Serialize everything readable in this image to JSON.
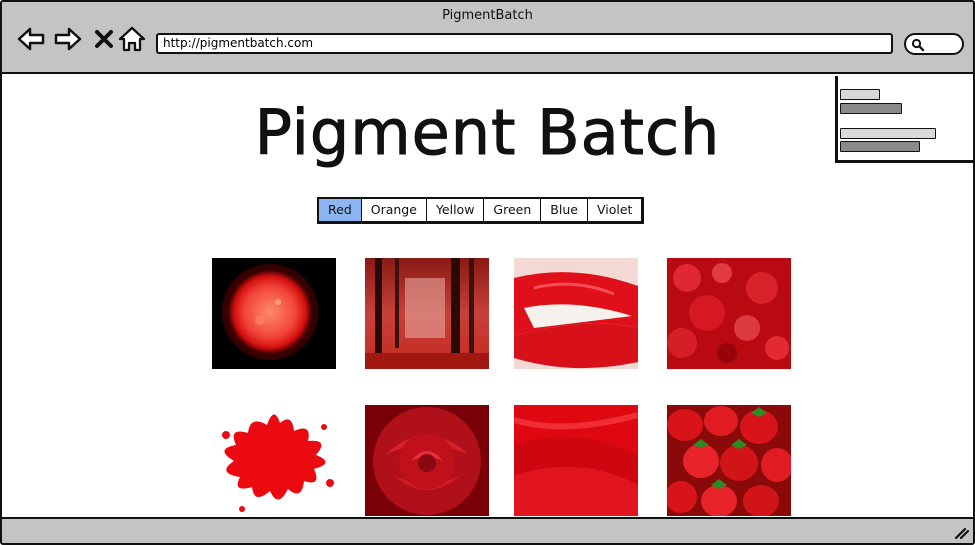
{
  "window": {
    "title": "PigmentBatch"
  },
  "toolbar": {
    "url": "http://pigmentbatch.com",
    "icons": [
      "back-arrow-icon",
      "forward-arrow-icon",
      "close-x-icon",
      "home-icon",
      "search-icon"
    ]
  },
  "page": {
    "heading": "Pigment Batch",
    "tabs": [
      {
        "label": "Red",
        "selected": true
      },
      {
        "label": "Orange",
        "selected": false
      },
      {
        "label": "Yellow",
        "selected": false
      },
      {
        "label": "Green",
        "selected": false
      },
      {
        "label": "Blue",
        "selected": false
      },
      {
        "label": "Violet",
        "selected": false
      }
    ],
    "gallery": [
      "red-sun-image",
      "red-forest-image",
      "red-lips-image",
      "red-bokeh-image",
      "red-paint-splat-image",
      "red-rose-image",
      "red-abstract-waves-image",
      "strawberries-image"
    ]
  },
  "colors": {
    "chrome": "#c4c4c4",
    "selected_tab": "#8cb4f0",
    "accent_red": "#e0101a"
  }
}
